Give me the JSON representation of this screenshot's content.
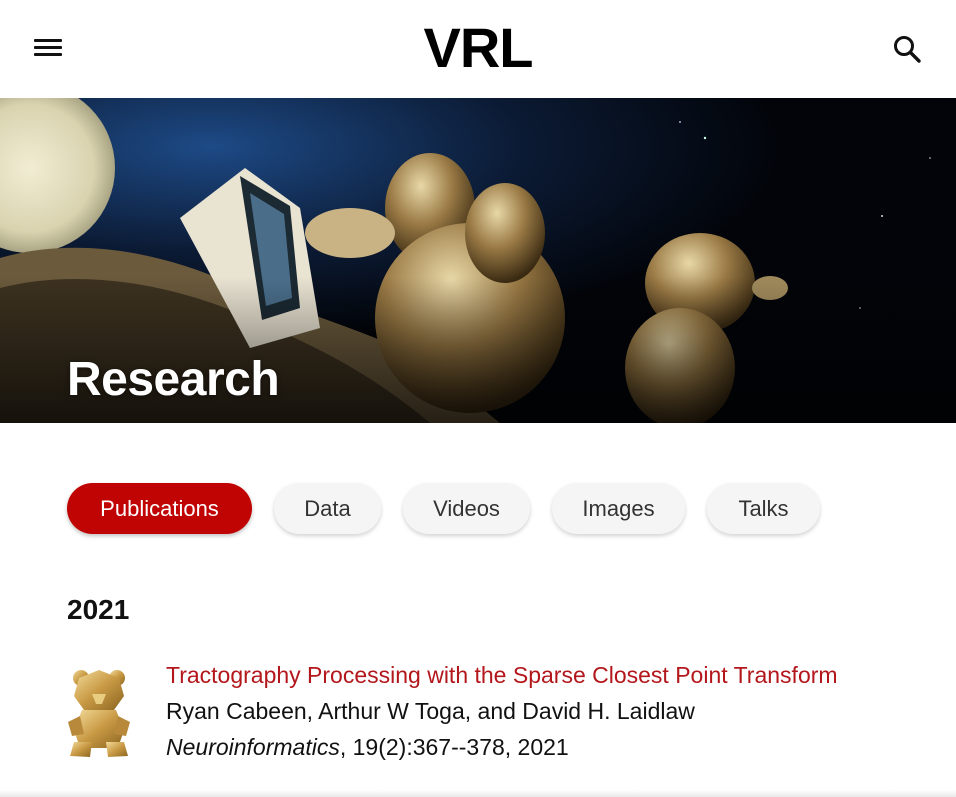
{
  "header": {
    "logo": "VRL",
    "menu_icon": "hamburger-menu-icon",
    "search_icon": "search-icon"
  },
  "hero": {
    "title": "Research",
    "image": "teddy-bears-in-space-illustration"
  },
  "tabs": [
    {
      "label": "Publications",
      "active": true
    },
    {
      "label": "Data",
      "active": false
    },
    {
      "label": "Videos",
      "active": false
    },
    {
      "label": "Images",
      "active": false
    },
    {
      "label": "Talks",
      "active": false
    }
  ],
  "sections": [
    {
      "year": "2021",
      "publications": [
        {
          "title": "Tractography Processing with the Sparse Closest Point Transform",
          "authors": "Ryan Cabeen, Arthur W Toga, and David H. Laidlaw",
          "journal": "Neuroinformatics",
          "details": ", 19(2):367--378, 2021",
          "thumbnail": "gold-teddy-bear-icon"
        }
      ]
    }
  ],
  "colors": {
    "accent": "#c00404",
    "link": "#b3171b",
    "tab_bg": "#f5f5f5"
  }
}
